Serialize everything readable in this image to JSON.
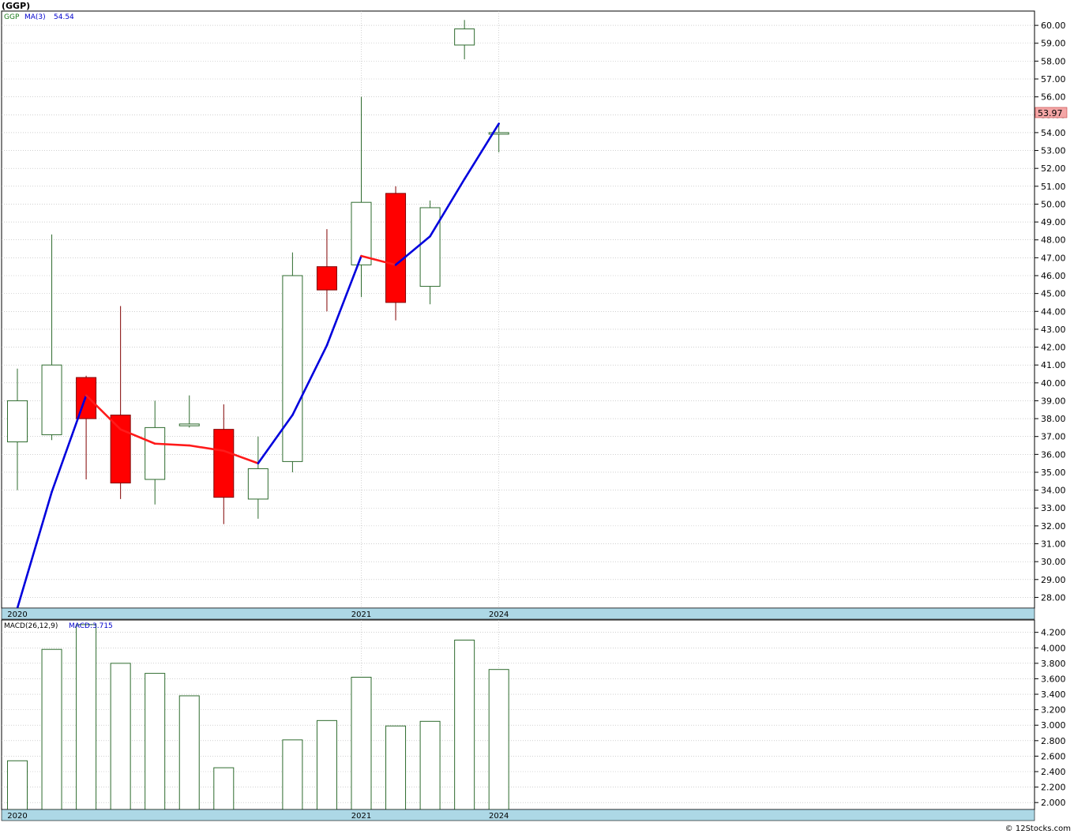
{
  "header": {
    "title": "(GGP)"
  },
  "price_panel": {
    "legend_symbol": "GGP",
    "legend_ma_label": "MA(3)",
    "legend_ma_value": "54.54",
    "last_price_label": "53.97"
  },
  "macd_panel": {
    "legend_label": "MACD(26,12,9)",
    "legend_value": "MACD:3.715"
  },
  "x_axis_labels": [
    "2020",
    "2021",
    "2024"
  ],
  "footer": {
    "copyright": "© 12Stocks.com"
  },
  "colors": {
    "up_candle_border": "#2e6b2e",
    "down_candle_fill": "#ff0000",
    "ma_line_up": "#0000dd",
    "ma_line_down": "#ff1a1a",
    "axis_band": "#add8e6",
    "grid": "#b4b4b4",
    "price_tag": "#f4a6a6"
  },
  "chart_data": [
    {
      "type": "candlestick",
      "title": "(GGP)",
      "y_ticks": [
        "28.00",
        "29.00",
        "30.00",
        "31.00",
        "32.00",
        "33.00",
        "34.00",
        "35.00",
        "36.00",
        "37.00",
        "38.00",
        "39.00",
        "40.00",
        "41.00",
        "42.00",
        "43.00",
        "44.00",
        "45.00",
        "46.00",
        "47.00",
        "48.00",
        "49.00",
        "50.00",
        "51.00",
        "52.00",
        "53.00",
        "54.00",
        "55.00",
        "56.00",
        "57.00",
        "58.00",
        "59.00",
        "60.00"
      ],
      "ylim": [
        27.4,
        60.8
      ],
      "grid": true,
      "x_period_labels": [
        {
          "label": "2020",
          "index": 0
        },
        {
          "label": "2021",
          "index": 10
        },
        {
          "label": "2024",
          "index": 14
        }
      ],
      "candles": [
        {
          "open": 36.7,
          "high": 40.8,
          "low": 34.0,
          "close": 39.0
        },
        {
          "open": 37.1,
          "high": 48.3,
          "low": 36.8,
          "close": 41.0
        },
        {
          "open": 40.3,
          "high": 40.4,
          "low": 34.6,
          "close": 38.0
        },
        {
          "open": 38.2,
          "high": 44.3,
          "low": 33.5,
          "close": 34.4
        },
        {
          "open": 34.6,
          "high": 39.0,
          "low": 33.2,
          "close": 37.5
        },
        {
          "open": 37.6,
          "high": 39.3,
          "low": 37.5,
          "close": 37.7
        },
        {
          "open": 37.4,
          "high": 38.8,
          "low": 32.1,
          "close": 33.6
        },
        {
          "open": 33.5,
          "high": 37.0,
          "low": 32.4,
          "close": 35.2
        },
        {
          "open": 35.6,
          "high": 47.3,
          "low": 35.0,
          "close": 46.0
        },
        {
          "open": 46.5,
          "high": 48.6,
          "low": 44.0,
          "close": 45.2
        },
        {
          "open": 46.6,
          "high": 56.0,
          "low": 44.8,
          "close": 50.1
        },
        {
          "open": 50.6,
          "high": 51.0,
          "low": 43.5,
          "close": 44.5
        },
        {
          "open": 45.4,
          "high": 50.2,
          "low": 44.4,
          "close": 49.8
        },
        {
          "open": 58.9,
          "high": 60.3,
          "low": 58.1,
          "close": 59.8
        },
        {
          "open": 54.0,
          "high": 54.5,
          "low": 52.9,
          "close": 54.0
        }
      ],
      "ma_series": {
        "name": "MA(3)",
        "points": [
          {
            "x": 0,
            "y": 27.4
          },
          {
            "x": 1,
            "y": 33.9
          },
          {
            "x": 2,
            "y": 39.3
          },
          {
            "x": 3,
            "y": 37.4
          },
          {
            "x": 4,
            "y": 36.6
          },
          {
            "x": 5,
            "y": 36.5
          },
          {
            "x": 6,
            "y": 36.2
          },
          {
            "x": 7,
            "y": 35.5
          },
          {
            "x": 8,
            "y": 38.2
          },
          {
            "x": 9,
            "y": 42.1
          },
          {
            "x": 10,
            "y": 47.1
          },
          {
            "x": 11,
            "y": 46.6
          },
          {
            "x": 12,
            "y": 48.2
          },
          {
            "x": 13,
            "y": 51.4
          },
          {
            "x": 14,
            "y": 54.5
          }
        ],
        "colors_by_segment": [
          "blue",
          "blue",
          "red",
          "red",
          "red",
          "red",
          "red",
          "blue",
          "blue",
          "blue",
          "red",
          "blue",
          "blue",
          "blue"
        ]
      }
    },
    {
      "type": "bar",
      "title": "MACD(26,12,9)",
      "y_ticks": [
        "2.000",
        "2.200",
        "2.400",
        "2.600",
        "2.800",
        "3.000",
        "3.200",
        "3.400",
        "3.600",
        "3.800",
        "4.000",
        "4.200"
      ],
      "ylim": [
        1.91,
        4.36
      ],
      "values": [
        2.54,
        3.98,
        4.3,
        3.8,
        3.67,
        3.38,
        2.45,
        null,
        2.81,
        3.06,
        3.62,
        2.99,
        3.05,
        4.1,
        3.72
      ],
      "x_period_labels": [
        {
          "label": "2020",
          "index": 0
        },
        {
          "label": "2021",
          "index": 10
        },
        {
          "label": "2024",
          "index": 14
        }
      ]
    }
  ]
}
